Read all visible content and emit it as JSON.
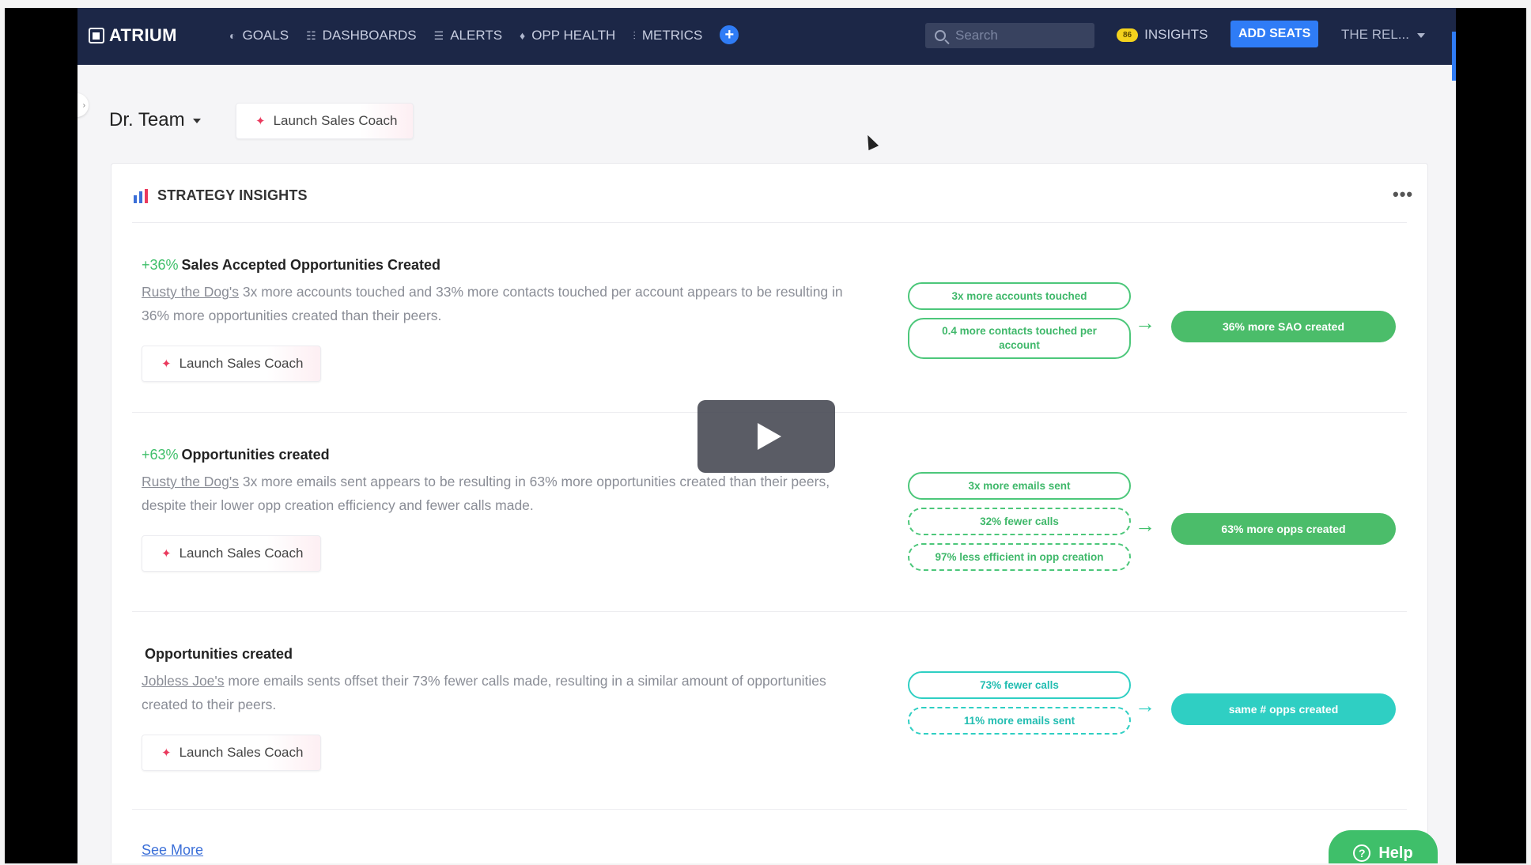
{
  "nav": {
    "logo": "ATRIUM",
    "items": [
      {
        "label": "GOALS",
        "icon": "goals-icon"
      },
      {
        "label": "DASHBOARDS",
        "icon": "dashboards-icon"
      },
      {
        "label": "ALERTS",
        "icon": "alerts-icon"
      },
      {
        "label": "OPP HEALTH",
        "icon": "opp-health-icon"
      },
      {
        "label": "METRICS",
        "icon": "metrics-icon"
      }
    ],
    "search_placeholder": "Search",
    "insights_badge": "86",
    "insights_label": "INSIGHTS",
    "add_seats": "ADD SEATS",
    "user": "THE REL..."
  },
  "header": {
    "team": "Dr. Team",
    "coach_label": "Launch Sales Coach"
  },
  "card": {
    "title": "STRATEGY INSIGHTS",
    "more": "•••",
    "insights": [
      {
        "pct": "+36%",
        "title": "Sales Accepted Opportunities Created",
        "rep": "Rusty the Dog's",
        "desc": " 3x more accounts touched and 33% more contacts touched per account appears to be resulting in 36% more opportunities created than their peers.",
        "coach": "Launch Sales Coach",
        "pills": [
          "3x more accounts touched",
          "0.4 more contacts touched per account"
        ],
        "result": "36% more SAO created"
      },
      {
        "pct": "+63%",
        "title": "Opportunities created",
        "rep": "Rusty the Dog's",
        "desc": " 3x more emails sent appears to be resulting in 63% more opportunities created than their peers, despite their lower opp creation efficiency and fewer calls made.",
        "coach": "Launch Sales Coach",
        "pills": [
          "3x more emails sent",
          "32% fewer calls",
          "97% less efficient in opp creation"
        ],
        "result": "63% more opps created"
      },
      {
        "pct": "",
        "title": "Opportunities created",
        "rep": "Jobless Joe's",
        "desc": " more emails sents offset their 73% fewer calls made, resulting in a similar amount of opportunities created to their peers.",
        "coach": "Launch Sales Coach",
        "pills": [
          "73% fewer calls",
          "11% more emails sent"
        ],
        "result": "same # opps created"
      }
    ],
    "see_more": "See More"
  },
  "help": "Help",
  "colors": {
    "nav_bg": "#1c2747",
    "accent_blue": "#2f7cf6",
    "positive_green": "#4bbd6a",
    "neutral_teal": "#2fcfc3",
    "coach_pink": "#ea3a5d"
  }
}
